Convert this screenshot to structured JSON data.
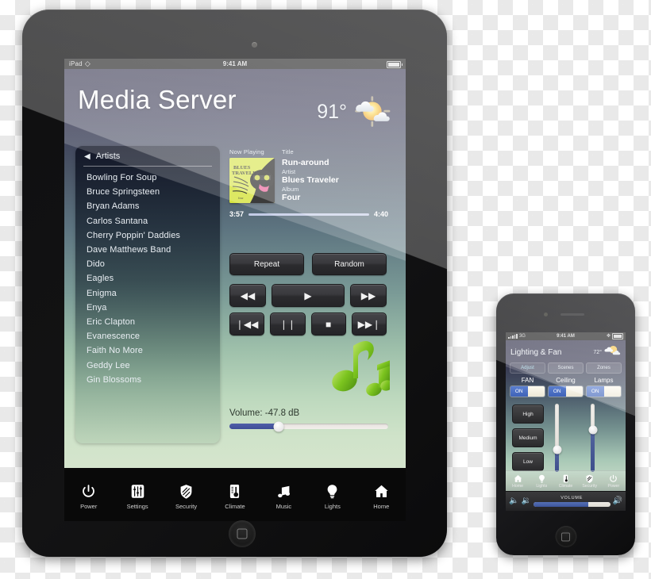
{
  "ipad": {
    "status_bar": {
      "carrier": "iPad",
      "wifi_icon": "wifi-icon",
      "time": "9:41 AM",
      "battery_icon": "battery-icon"
    },
    "header": {
      "title": "Media Server",
      "temperature": "91°",
      "weather_icon": "partly-cloudy-icon"
    },
    "artists_panel": {
      "back_icon": "back-triangle-icon",
      "title": "Artists",
      "items": [
        "Bowling For Soup",
        "Bruce Springsteen",
        "Bryan Adams",
        "Carlos Santana",
        "Cherry Poppin' Daddies",
        "Dave Matthews Band",
        "Dido",
        "Eagles",
        "Enigma",
        "Enya",
        "Eric Clapton",
        "Evanescence",
        "Faith No More",
        "Geddy Lee",
        "Gin Blossoms"
      ]
    },
    "now_playing": {
      "section_label": "Now Playing",
      "album_art_name": "album-art-blues-traveler-four",
      "album_art_text": {
        "line1": "BLUES",
        "line2": "TRAVELER",
        "line3": "four"
      },
      "fields": [
        {
          "key": "Title",
          "value": "Run-around"
        },
        {
          "key": "Artist",
          "value": "Blues Traveler"
        },
        {
          "key": "Album",
          "value": "Four"
        }
      ],
      "elapsed": "3:57",
      "duration": "4:40",
      "progress_percent": 86
    },
    "transport": {
      "repeat_label": "Repeat",
      "random_label": "Random",
      "row_a": [
        {
          "name": "rewind-button",
          "glyph": "◀◀"
        },
        {
          "name": "play-button",
          "glyph": "▶"
        },
        {
          "name": "fast-forward-button",
          "glyph": "▶▶"
        }
      ],
      "row_b": [
        {
          "name": "previous-track-button",
          "glyph": "❘◀◀"
        },
        {
          "name": "pause-button",
          "glyph": "❘❘"
        },
        {
          "name": "stop-button",
          "glyph": "■"
        },
        {
          "name": "next-track-button",
          "glyph": "▶▶❘"
        }
      ]
    },
    "volume": {
      "label": "Volume: -47.8 dB",
      "percent": 31
    },
    "decor": {
      "music_note_icon": "green-music-note-icon"
    },
    "nav": [
      {
        "name": "power",
        "label": "Power",
        "icon": "power-icon"
      },
      {
        "name": "settings",
        "label": "Settings",
        "icon": "sliders-icon"
      },
      {
        "name": "security",
        "label": "Security",
        "icon": "shield-icon"
      },
      {
        "name": "climate",
        "label": "Climate",
        "icon": "thermometer-icon"
      },
      {
        "name": "music",
        "label": "Music",
        "icon": "music-note-icon"
      },
      {
        "name": "lights",
        "label": "Lights",
        "icon": "lightbulb-icon"
      },
      {
        "name": "home",
        "label": "Home",
        "icon": "house-icon"
      }
    ]
  },
  "iphone": {
    "status_bar": {
      "network": "3G",
      "time": "9:41 AM",
      "bluetooth_icon": "bluetooth-icon",
      "battery_icon": "battery-icon"
    },
    "header": {
      "title": "Lighting & Fan",
      "temperature": "72°",
      "weather_icon": "partly-cloudy-icon"
    },
    "segments": [
      {
        "label": "Adjust",
        "selected": true
      },
      {
        "label": "Scenes",
        "selected": false
      },
      {
        "label": "Zones",
        "selected": false
      }
    ],
    "zones": [
      {
        "name": "FAN",
        "state": "ON"
      },
      {
        "name": "Ceiling",
        "state": "ON"
      },
      {
        "name": "Lamps",
        "state": "ON"
      }
    ],
    "fan_speeds": [
      {
        "label": "High"
      },
      {
        "label": "Medium"
      },
      {
        "label": "Low"
      }
    ],
    "sliders": [
      {
        "name": "ceiling-slider",
        "percent": 33
      },
      {
        "name": "lamps-slider",
        "percent": 62
      }
    ],
    "nav": [
      {
        "name": "home",
        "label": "Home",
        "icon": "house-icon"
      },
      {
        "name": "lights",
        "label": "Lights",
        "icon": "lightbulb-icon"
      },
      {
        "name": "climate",
        "label": "Climate",
        "icon": "thermometer-icon"
      },
      {
        "name": "security",
        "label": "Security",
        "icon": "shield-icon"
      },
      {
        "name": "power",
        "label": "Power",
        "icon": "power-icon"
      }
    ],
    "volume_bar": {
      "label": "VOLUME",
      "percent": 72,
      "left_icons": [
        "speaker-mute-icon",
        "speaker-low-icon"
      ],
      "right_icon": "speaker-high-icon"
    }
  }
}
